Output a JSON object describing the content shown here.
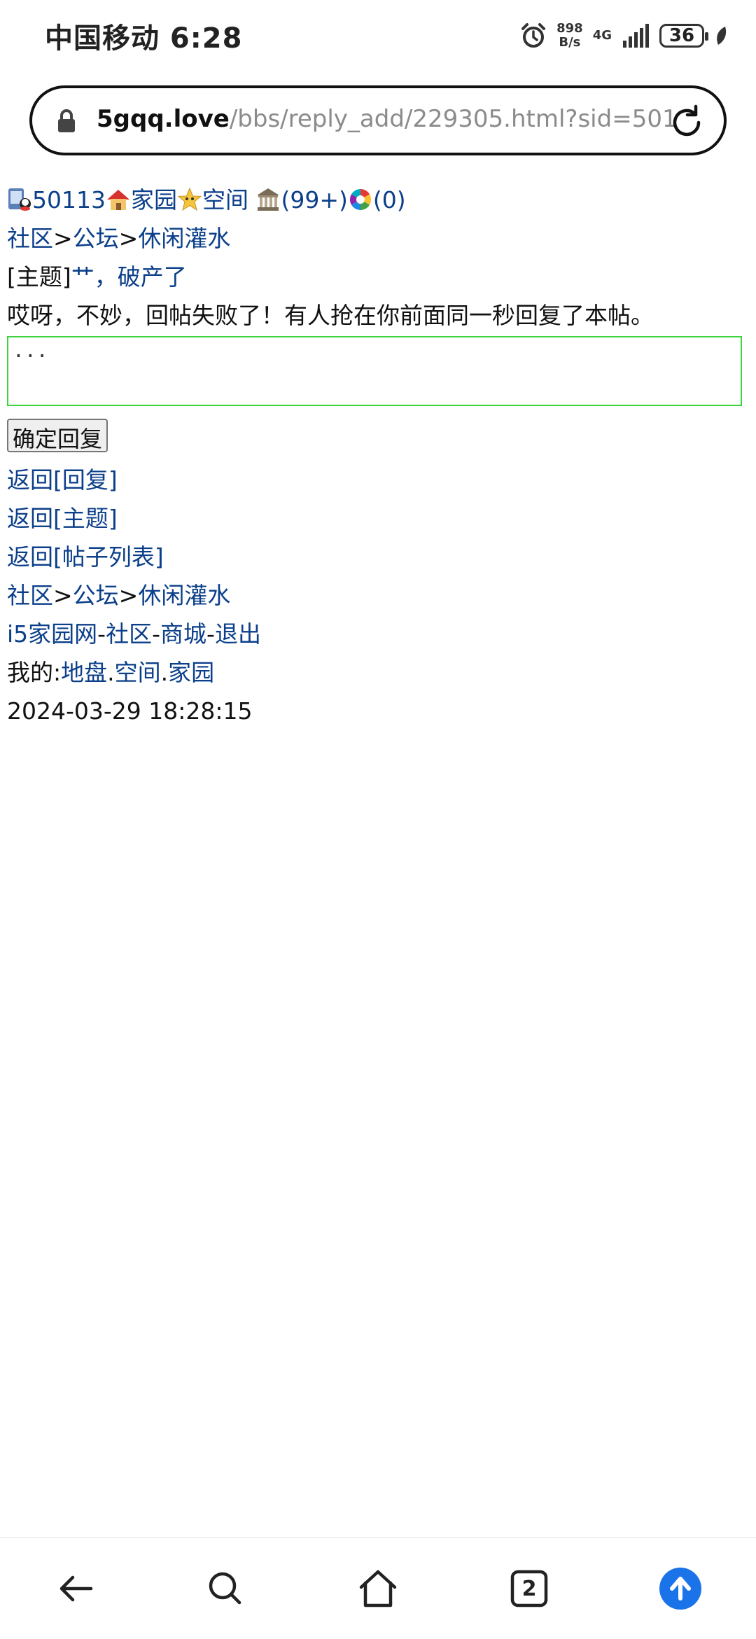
{
  "status": {
    "carrier_time": "中国移动 6:28",
    "speed_value": "898",
    "speed_unit": "B/s",
    "network": "4G",
    "battery": "36"
  },
  "address": {
    "host": "5gqq.love",
    "path": "/bbs/reply_add/229305.html?sid=501"
  },
  "userbar": {
    "user_id": "50113",
    "home": "家园",
    "space": "空间",
    "messages": "(99+)",
    "notices": "(0)"
  },
  "breadcrumb": {
    "root": "社区",
    "sep": ">",
    "forum": "公坛",
    "board": "休闲灌水"
  },
  "topic": {
    "prefix": "[主题]",
    "title": "艹，破产了"
  },
  "error_message": "哎呀，不妙，回帖失败了！有人抢在你前面同一秒回复了本帖。",
  "reply_box": {
    "value": "..."
  },
  "submit_label": "确定回复",
  "links": {
    "back_reply": "返回[回复]",
    "back_topic": "返回[主题]",
    "back_list": "返回[帖子列表]"
  },
  "footer": {
    "site": "i5家园网",
    "dash": "-",
    "community": "社区",
    "mall": "商城",
    "logout": "退出",
    "mine_label": "我的:",
    "land": "地盘",
    "dot": ".",
    "space": "空间",
    "home": "家园",
    "datetime": "2024-03-29 18:28:15"
  },
  "nav": {
    "tabs_count": "2"
  }
}
